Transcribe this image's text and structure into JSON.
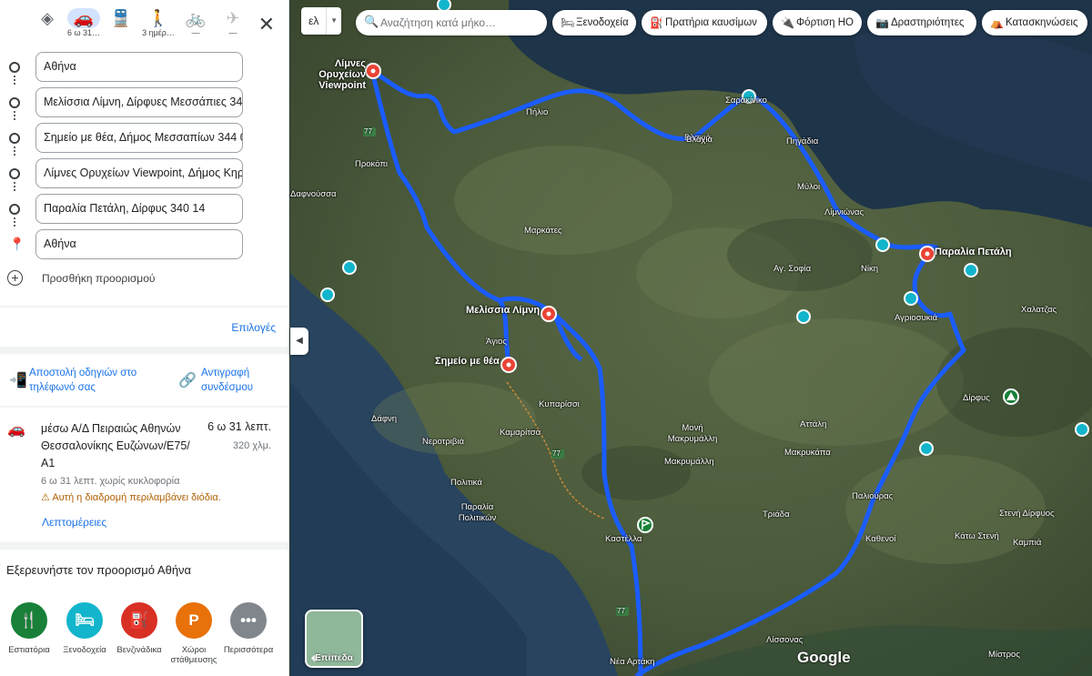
{
  "panel": {
    "modes": [
      {
        "name": "best-mode",
        "icon": "◈",
        "label": "",
        "state": "normal"
      },
      {
        "name": "car-mode",
        "icon": "🚗",
        "label": "6 ω 31…",
        "state": "selected"
      },
      {
        "name": "transit-mode",
        "icon": "🚆",
        "label": "",
        "state": "normal"
      },
      {
        "name": "walk-mode",
        "icon": "🚶",
        "label": "3 ημέρ…",
        "state": "normal"
      },
      {
        "name": "bike-mode",
        "icon": "🚲",
        "label": "—",
        "state": "disabled"
      },
      {
        "name": "flight-mode",
        "icon": "✈",
        "label": "—",
        "state": "disabled"
      }
    ],
    "close_icon": "✕",
    "stops": [
      "Αθήνα",
      "Μελίσσια Λίμνη, Δίρφυες Μεσσάπιες 34",
      "Σημείο με θέα, Δήμος Μεσσαπίων 344 0",
      "Λίμνες Ορυχείων Viewpoint, Δήμος Κηρε",
      "Παραλία Πετάλη, Δίρφυς 340 14",
      "Αθήνα"
    ],
    "add_destination": "Προσθήκη προορισμού",
    "options": "Επιλογές",
    "send_to_phone": "Αποστολή οδηγιών στο τηλέφωνό σας",
    "copy_link": "Αντιγραφή συνδέσμου",
    "route": {
      "name": "μέσω Α/Δ Πειραιώς Αθηνών Θεσσαλονίκης Ευζώνων/Ε75/Α1",
      "time": "6 ω 31 λεπτ.",
      "distance": "320 χλμ.",
      "traffic": "6 ω 31 λεπτ. χωρίς κυκλοφορία",
      "warning": "Αυτή η διαδρομή περιλαμβάνει διόδια.",
      "details": "Λεπτομέρειες"
    },
    "explore_title": "Εξερευνήστε τον προορισμό Αθήνα",
    "categories": [
      {
        "label": "Εστιατόρια",
        "icon": "🍴",
        "color": "#188038"
      },
      {
        "label": "Ξενοδοχεία",
        "icon": "🛏",
        "color": "#12b5cb"
      },
      {
        "label": "Βενζινάδικα",
        "icon": "⛽",
        "color": "#d93025"
      },
      {
        "label": "Χώροι στάθμευσης",
        "icon": "P",
        "color": "#e8710a"
      },
      {
        "label": "Περισσότερα",
        "icon": "•••",
        "color": "#80868b"
      }
    ]
  },
  "map": {
    "language": "ελ",
    "search_placeholder": "Αναζήτηση κατά μήκο…",
    "chips": [
      {
        "label": "Ξενοδοχεία",
        "icon": "🛏"
      },
      {
        "label": "Πρατήρια καυσίμων",
        "icon": "⛽"
      },
      {
        "label": "Φόρτιση ΗΟ",
        "icon": "🔌"
      },
      {
        "label": "Δραστηριότητες",
        "icon": "📷"
      },
      {
        "label": "Κατασκηνώσεις",
        "icon": "⛺"
      }
    ],
    "waypoints": [
      {
        "label": "Λίμνες Ορυχείων Viewpoint"
      },
      {
        "label": "Μελίσσια Λίμνη"
      },
      {
        "label": "Σημείο με θέα"
      },
      {
        "label": "Παραλία Πετάλη"
      }
    ],
    "places": [
      "Πήλιο",
      "Βλαχιά",
      "Σαρακίνικο",
      "Πηγάδια",
      "Μύλοι",
      "Λίμνιώνας",
      "Νίκη",
      "Αγ. Σοφία",
      "Μαρκάτες",
      "Προκόπι",
      "Δαφνούσσα",
      "Αγριοσυκιά",
      "Χαλατζας",
      "Δίρφυς",
      "Άγιος",
      "Κυπαρίσσι",
      "Καμαρίτσα",
      "Δάφνη",
      "Νεροτριβιά",
      "Μονή Μακρυμάλλη",
      "Μακρυμάλλη",
      "Αττάλη",
      "Μακρυκάπα",
      "Πολιτικά",
      "Παραλία Πολιτικών",
      "Τριάδα",
      "Παλιούρας",
      "Καστέλλα",
      "Καθενοί",
      "Στενή Δίρφυος",
      "Κάτω Στενή",
      "Καμπιά",
      "Λίσσονας",
      "Νέα Αρτάκη",
      "Μίστρος",
      "Βλάχια"
    ],
    "road_number": "77",
    "layers_label": "Επίπεδα",
    "attribution": "Google",
    "route_color": "#1a5cff"
  }
}
